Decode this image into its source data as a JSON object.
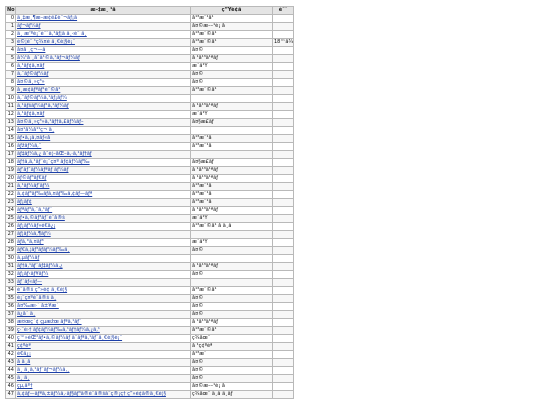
{
  "headers": {
    "no": "No",
    "name": "æ–‡æ¸ ¹å",
    "date": "ç”Ÿè¢ã",
    "note": "è¨˜"
  },
  "rows": [
    {
      "no": "0",
      "name": "ä¸‡æ¸¶æ–æ¢ê£è¨¬ãƒ¡ã",
      "date": "å¹³æˆ¹å¹",
      "note": ""
    },
    {
      "no": "1",
      "name": "ãƒ¬ãƒ¼ãƒ",
      "date": "å¤©æ––¹è¡ å",
      "note": ""
    },
    {
      "no": "2",
      "name": "ä¸ æ‘ºè¡¨è¨˜ã‚¹ãƒ¦ã ä¸‹è¨ ä¸",
      "date": "å¹³æˆ©å¹",
      "note": ""
    },
    {
      "no": "3",
      "name": "è©¦é¨ ¹ç¾¤è ä¸€è¦§è¡¨",
      "date": "å¹³æˆ©å¹",
      "note": "18™å¾¹"
    },
    {
      "no": "4",
      "name": "å¤å ¸ç¬—ã",
      "date": "å¤©",
      "note": ""
    },
    {
      "no": "5",
      "name": "å¼¹å ¸å¯ä¹©ã‚¹ãƒ¬ãƒ¼ãƒ",
      "date": "å ¹å¹³ä¹ªãƒ",
      "note": ""
    },
    {
      "no": "6",
      "name": "ã‚¹ãƒ¢ã‚¤ãƒ",
      "date": "æ˜­ä¹Ÿ",
      "note": ""
    },
    {
      "no": "7",
      "name": "ã‚¯ãƒ©ãƒ¼ãƒ",
      "date": "å¤©",
      "note": ""
    },
    {
      "no": "8",
      "name": "å¤©ä¸»ç³»",
      "date": "å¤©",
      "note": ""
    },
    {
      "no": "9",
      "name": "å¸æ¢ãƒªãƒ¹è¨©å¹",
      "date": "å¹³æˆ©å¹",
      "note": ""
    },
    {
      "no": "10",
      "name": "ã‚¯ãƒ©ãƒ¼ã‚¹ãƒ¡ãƒ¼",
      "date": "",
      "note": ""
    },
    {
      "no": "11",
      "name": "ã‚¹ãƒšãƒ¼ãƒ¹ã‚¹ãƒ¼ãƒ",
      "date": "å ¹å¹³ä¹ªãƒ",
      "note": ""
    },
    {
      "no": "12",
      "name": "ã‚¹ãƒ¢ã‚¤ãƒ",
      "date": "æ˜­ä¹Ÿ",
      "note": ""
    },
    {
      "no": "13",
      "name": "å¤©ä¸»ç³»ã‚¹ãƒ†ã‚£ãƒ¼ãƒ–",
      "date": "å¤§æ­£ãƒ",
      "note": ""
    },
    {
      "no": "14",
      "name": "å¤¹å¼å¹¹ç¬ ä¸",
      "date": "",
      "note": ""
    },
    {
      "no": "15",
      "name": "ãƒ•ã‚¡ã‚¤ãƒ«å",
      "date": "å¹³æˆ¹å",
      "note": ""
    },
    {
      "no": "16",
      "name": "ãƒžãƒ¼ã‚¯",
      "date": "å¹³æˆ¹å",
      "note": ""
    },
    {
      "no": "17",
      "name": "ãƒ‡ãƒ¼ã‚¿ å¯è¦–åŒ–ã‚·ã‚¹ãƒ†ãƒ ",
      "date": "",
      "note": ""
    },
    {
      "no": "18",
      "name": "ãƒ†ã‚­ã‚¹ãƒˆè¡¨ç¤º ãƒ¢ãƒ¼ãƒ‰",
      "date": "å¤§æ­£ãƒ",
      "note": ""
    },
    {
      "no": "19",
      "name": "ãƒ‘ãƒ¯ãƒ¼ãƒªãƒ ãƒ¼ãƒ",
      "date": "å ¹å¹³ä¹ªãƒ",
      "note": ""
    },
    {
      "no": "20",
      "name": "ãƒ©ãƒ³ãƒ€ãƒ ",
      "date": "å ¹å¹³ä¹ªãƒ",
      "note": ""
    },
    {
      "no": "21",
      "name": "ã‚¹ãƒ¼ãƒ‘ãƒ¼",
      "date": "å¹³æˆ¹å",
      "note": ""
    },
    {
      "no": "22",
      "name": "ã‚¢ãƒ³ãƒ‰ãƒ­ã‚¤ãƒ‰ã‚¢ãƒ—ãƒª",
      "date": "å¹³æˆ¹å",
      "note": ""
    },
    {
      "no": "23",
      "name": "ãƒ¡ãƒ¢",
      "date": "å¹³æˆ¹å",
      "note": ""
    },
    {
      "no": "24",
      "name": "ãƒªãƒ³ã‚¯ã‚¹ãƒˆ",
      "date": "å ¹å¹³ä¹ªãƒ",
      "note": ""
    },
    {
      "no": "25",
      "name": "ãƒ•ã‚©ãƒ³ãƒˆè¨­å®š",
      "date": "æ˜­ä¹Ÿ",
      "note": ""
    },
    {
      "no": "26",
      "name": "ãƒ¡ãƒ¼ãƒ«é€ä¿¡",
      "date": "å¹³æˆ©å¹ å ä¸ã",
      "note": ""
    },
    {
      "no": "27",
      "name": "ãƒ¦ãƒ¼ã‚¶ãƒ¼",
      "date": "",
      "note": ""
    },
    {
      "no": "28",
      "name": "ãƒ­ã‚°ã‚¤ãƒ³",
      "date": "æ˜­ä¹Ÿ",
      "note": ""
    },
    {
      "no": "29",
      "name": "ãƒ€ã‚¦ãƒ³ãƒ­ãƒ¼ãƒ‰ä¸",
      "date": "å¤©",
      "note": ""
    },
    {
      "no": "30",
      "name": "ã‚µãƒ¼ãƒ",
      "date": "",
      "note": ""
    },
    {
      "no": "31",
      "name": "ãƒ†ã‚¹ãƒˆãƒ‡ãƒ¼ã‚¿",
      "date": "å ¹å¹³ä¹ªãƒ",
      "note": ""
    },
    {
      "no": "32",
      "name": "ãƒ¡ãƒ‹ãƒ¥ãƒ¼",
      "date": "å¤©",
      "note": ""
    },
    {
      "no": "33",
      "name": "ãƒ˜ãƒ«ãƒ—",
      "date": "",
      "note": ""
    },
    {
      "no": "34",
      "name": "è¨­å®š ç”»é¢ ä¸€è¦§",
      "date": "å¹³æˆ©å¹",
      "note": ""
    },
    {
      "no": "35",
      "name": "è¡¨ç¤ºè¨­å®š ä¸",
      "date": "å¤©",
      "note": ""
    },
    {
      "no": "36",
      "name": "å¤‰æ›´ å±¥æ­´",
      "date": "å¤©",
      "note": ""
    },
    {
      "no": "37",
      "name": "ä¿å­˜ ä¸",
      "date": "å¤©",
      "note": ""
    },
    {
      "no": "38",
      "name": "æ¤œç´¢ çµæžœ ãƒªã‚¹ãƒˆ",
      "date": "å ¹å¹³ä¹ªãƒ",
      "note": ""
    },
    {
      "no": "39",
      "name": "ç·¨é›† ãƒ¢ãƒ¼ãƒ‰ã‚¹ãƒ†ãƒ¼ã‚¿ã‚¹",
      "date": "å¹³æˆ©å¹",
      "note": ""
    },
    {
      "no": "40",
      "name": "ç™»éŒ²ãƒ•ã‚©ãƒ¼ãƒ ã¨ãƒªã‚¹ãƒˆä¸€è¦§è¡¨",
      "date": "ç¾åœ¨",
      "note": ""
    },
    {
      "no": "41",
      "name": "ç¢ºèª",
      "date": "å ¹ç¢ºèª",
      "note": ""
    },
    {
      "no": "42",
      "name": "é€ä¿¡",
      "date": "å¹³æˆ",
      "note": ""
    },
    {
      "no": "43",
      "name": "å ä¸å",
      "date": "å¤©",
      "note": ""
    },
    {
      "no": "44",
      "name": "ä¸ ä¸ã‚¹ãƒˆãƒ¬ãƒ¼ã‚¸",
      "date": "å¤©",
      "note": ""
    },
    {
      "no": "45",
      "name": "ä¸ ä¸",
      "date": "å¤©",
      "note": ""
    },
    {
      "no": "46",
      "name": "çµ‚äº†",
      "date": "å¤©æ––¹è¡ å",
      "note": ""
    },
    {
      "no": "47",
      "name": "ã‚¢ãƒ—ãƒªã‚±ãƒ¼ã‚·ãƒ§ãƒ³ã®è¨­å®šã¨ç®¡ç† ç”»é¢ã®ä¸€è¦§",
      "date": "ç¾åœ¨ ä¸ã ä¸ãƒ",
      "note": ""
    }
  ]
}
